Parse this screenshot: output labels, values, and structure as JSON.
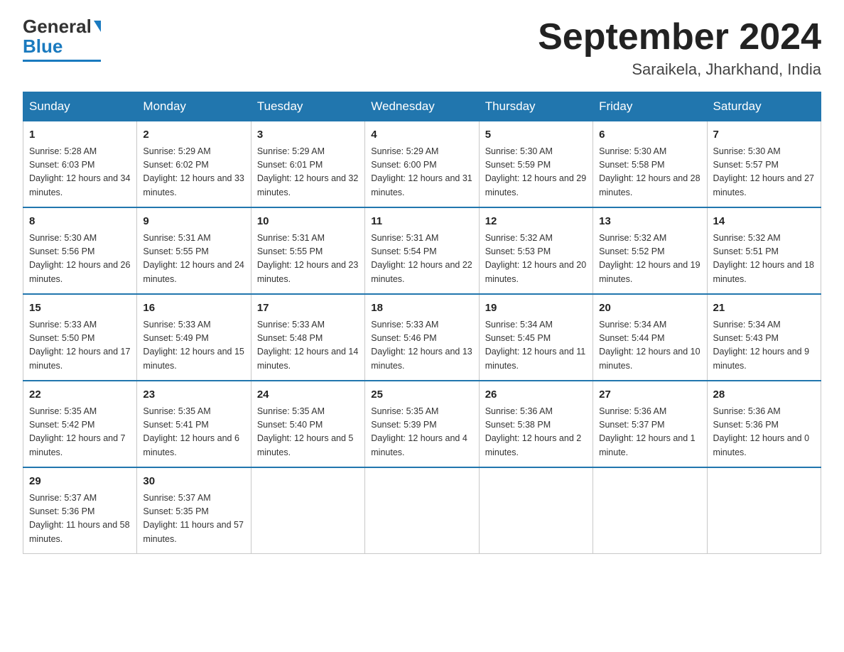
{
  "header": {
    "logo_general": "General",
    "logo_blue": "Blue",
    "month_title": "September 2024",
    "location": "Saraikela, Jharkhand, India"
  },
  "weekdays": [
    "Sunday",
    "Monday",
    "Tuesday",
    "Wednesday",
    "Thursday",
    "Friday",
    "Saturday"
  ],
  "weeks": [
    [
      {
        "day": "1",
        "sunrise": "Sunrise: 5:28 AM",
        "sunset": "Sunset: 6:03 PM",
        "daylight": "Daylight: 12 hours and 34 minutes."
      },
      {
        "day": "2",
        "sunrise": "Sunrise: 5:29 AM",
        "sunset": "Sunset: 6:02 PM",
        "daylight": "Daylight: 12 hours and 33 minutes."
      },
      {
        "day": "3",
        "sunrise": "Sunrise: 5:29 AM",
        "sunset": "Sunset: 6:01 PM",
        "daylight": "Daylight: 12 hours and 32 minutes."
      },
      {
        "day": "4",
        "sunrise": "Sunrise: 5:29 AM",
        "sunset": "Sunset: 6:00 PM",
        "daylight": "Daylight: 12 hours and 31 minutes."
      },
      {
        "day": "5",
        "sunrise": "Sunrise: 5:30 AM",
        "sunset": "Sunset: 5:59 PM",
        "daylight": "Daylight: 12 hours and 29 minutes."
      },
      {
        "day": "6",
        "sunrise": "Sunrise: 5:30 AM",
        "sunset": "Sunset: 5:58 PM",
        "daylight": "Daylight: 12 hours and 28 minutes."
      },
      {
        "day": "7",
        "sunrise": "Sunrise: 5:30 AM",
        "sunset": "Sunset: 5:57 PM",
        "daylight": "Daylight: 12 hours and 27 minutes."
      }
    ],
    [
      {
        "day": "8",
        "sunrise": "Sunrise: 5:30 AM",
        "sunset": "Sunset: 5:56 PM",
        "daylight": "Daylight: 12 hours and 26 minutes."
      },
      {
        "day": "9",
        "sunrise": "Sunrise: 5:31 AM",
        "sunset": "Sunset: 5:55 PM",
        "daylight": "Daylight: 12 hours and 24 minutes."
      },
      {
        "day": "10",
        "sunrise": "Sunrise: 5:31 AM",
        "sunset": "Sunset: 5:55 PM",
        "daylight": "Daylight: 12 hours and 23 minutes."
      },
      {
        "day": "11",
        "sunrise": "Sunrise: 5:31 AM",
        "sunset": "Sunset: 5:54 PM",
        "daylight": "Daylight: 12 hours and 22 minutes."
      },
      {
        "day": "12",
        "sunrise": "Sunrise: 5:32 AM",
        "sunset": "Sunset: 5:53 PM",
        "daylight": "Daylight: 12 hours and 20 minutes."
      },
      {
        "day": "13",
        "sunrise": "Sunrise: 5:32 AM",
        "sunset": "Sunset: 5:52 PM",
        "daylight": "Daylight: 12 hours and 19 minutes."
      },
      {
        "day": "14",
        "sunrise": "Sunrise: 5:32 AM",
        "sunset": "Sunset: 5:51 PM",
        "daylight": "Daylight: 12 hours and 18 minutes."
      }
    ],
    [
      {
        "day": "15",
        "sunrise": "Sunrise: 5:33 AM",
        "sunset": "Sunset: 5:50 PM",
        "daylight": "Daylight: 12 hours and 17 minutes."
      },
      {
        "day": "16",
        "sunrise": "Sunrise: 5:33 AM",
        "sunset": "Sunset: 5:49 PM",
        "daylight": "Daylight: 12 hours and 15 minutes."
      },
      {
        "day": "17",
        "sunrise": "Sunrise: 5:33 AM",
        "sunset": "Sunset: 5:48 PM",
        "daylight": "Daylight: 12 hours and 14 minutes."
      },
      {
        "day": "18",
        "sunrise": "Sunrise: 5:33 AM",
        "sunset": "Sunset: 5:46 PM",
        "daylight": "Daylight: 12 hours and 13 minutes."
      },
      {
        "day": "19",
        "sunrise": "Sunrise: 5:34 AM",
        "sunset": "Sunset: 5:45 PM",
        "daylight": "Daylight: 12 hours and 11 minutes."
      },
      {
        "day": "20",
        "sunrise": "Sunrise: 5:34 AM",
        "sunset": "Sunset: 5:44 PM",
        "daylight": "Daylight: 12 hours and 10 minutes."
      },
      {
        "day": "21",
        "sunrise": "Sunrise: 5:34 AM",
        "sunset": "Sunset: 5:43 PM",
        "daylight": "Daylight: 12 hours and 9 minutes."
      }
    ],
    [
      {
        "day": "22",
        "sunrise": "Sunrise: 5:35 AM",
        "sunset": "Sunset: 5:42 PM",
        "daylight": "Daylight: 12 hours and 7 minutes."
      },
      {
        "day": "23",
        "sunrise": "Sunrise: 5:35 AM",
        "sunset": "Sunset: 5:41 PM",
        "daylight": "Daylight: 12 hours and 6 minutes."
      },
      {
        "day": "24",
        "sunrise": "Sunrise: 5:35 AM",
        "sunset": "Sunset: 5:40 PM",
        "daylight": "Daylight: 12 hours and 5 minutes."
      },
      {
        "day": "25",
        "sunrise": "Sunrise: 5:35 AM",
        "sunset": "Sunset: 5:39 PM",
        "daylight": "Daylight: 12 hours and 4 minutes."
      },
      {
        "day": "26",
        "sunrise": "Sunrise: 5:36 AM",
        "sunset": "Sunset: 5:38 PM",
        "daylight": "Daylight: 12 hours and 2 minutes."
      },
      {
        "day": "27",
        "sunrise": "Sunrise: 5:36 AM",
        "sunset": "Sunset: 5:37 PM",
        "daylight": "Daylight: 12 hours and 1 minute."
      },
      {
        "day": "28",
        "sunrise": "Sunrise: 5:36 AM",
        "sunset": "Sunset: 5:36 PM",
        "daylight": "Daylight: 12 hours and 0 minutes."
      }
    ],
    [
      {
        "day": "29",
        "sunrise": "Sunrise: 5:37 AM",
        "sunset": "Sunset: 5:36 PM",
        "daylight": "Daylight: 11 hours and 58 minutes."
      },
      {
        "day": "30",
        "sunrise": "Sunrise: 5:37 AM",
        "sunset": "Sunset: 5:35 PM",
        "daylight": "Daylight: 11 hours and 57 minutes."
      },
      null,
      null,
      null,
      null,
      null
    ]
  ]
}
